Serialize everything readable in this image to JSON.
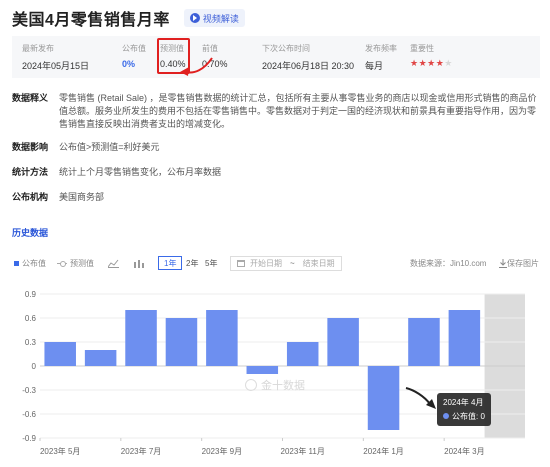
{
  "page": {
    "title": "美国4月零售销售月率",
    "video_label": "视频解读"
  },
  "info": {
    "latest_release": {
      "label": "最新发布",
      "value": "2024年05月15日"
    },
    "actual": {
      "label": "公布值",
      "value": "0%"
    },
    "forecast": {
      "label": "预测值",
      "value": "0.40%"
    },
    "previous": {
      "label": "前值",
      "value": "0.70%"
    },
    "next_release": {
      "label": "下次公布时间",
      "value": "2024年06月18日 20:30"
    },
    "frequency": {
      "label": "发布频率",
      "value": "每月"
    },
    "importance": {
      "label": "重要性",
      "stars_on": "★★★★",
      "stars_off": "★",
      "level": 4,
      "max": 5
    }
  },
  "sections": [
    {
      "label": "数据释义",
      "text": "零售销售 (Retail Sale) ，是零售销售数据的统计汇总，包括所有主要从事零售业务的商店以现金或信用形式销售的商品价值总额。服务业所发生的费用不包括在零售销售中。零售数据对于判定一国的经济现状和前景具有重要指导作用，因为零售销售直接反映出消费者支出的增减变化。"
    },
    {
      "label": "数据影响",
      "text": "公布值>预测值=利好美元"
    },
    {
      "label": "统计方法",
      "text": "统计上个月零售销售变化，公布月率数据"
    },
    {
      "label": "公布机构",
      "text": "美国商务部"
    }
  ],
  "history_link": "历史数据",
  "toolbar": {
    "legend_actual": "公布值",
    "legend_forecast": "预测值",
    "range_1y": "1年",
    "range_2y": "2年",
    "range_5y": "5年",
    "start_date": "开始日期",
    "tilde": "~",
    "end_date": "结束日期",
    "source": "数据来源：Jin10.com",
    "save_image": "保存图片"
  },
  "chart_data": {
    "type": "bar",
    "categories": [
      "2023年5月",
      "2023年6月",
      "2023年7月",
      "2023年8月",
      "2023年9月",
      "2023年10月",
      "2023年11月",
      "2023年12月",
      "2024年1月",
      "2024年2月",
      "2024年3月",
      "2024年4月"
    ],
    "x_tick_labels": [
      "2023年 5月",
      "2023年 7月",
      "2023年 9月",
      "2023年 11月",
      "2024年 1月",
      "2024年 3月"
    ],
    "series": [
      {
        "name": "公布值",
        "values": [
          0.3,
          0.2,
          0.7,
          0.6,
          0.7,
          -0.1,
          0.3,
          0.6,
          -0.8,
          0.6,
          0.7,
          0
        ]
      }
    ],
    "y_ticks": [
      "0.9",
      "0.6",
      "0.3",
      "0",
      "-0.3",
      "-0.6",
      "-0.9"
    ],
    "ylim": [
      -0.9,
      0.9
    ],
    "highlighted_category": "2024年4月",
    "bar_color": "#6d8ff0",
    "highlight_band_color": "#dcdcdc",
    "grid": true
  },
  "tooltip": {
    "date": "2024年 4月",
    "series_label": "公布值: 0"
  },
  "watermark": "金十数据",
  "colors": {
    "accent": "#3a6ae8",
    "highlight_border": "#e02020",
    "star_on": "#e04545"
  }
}
